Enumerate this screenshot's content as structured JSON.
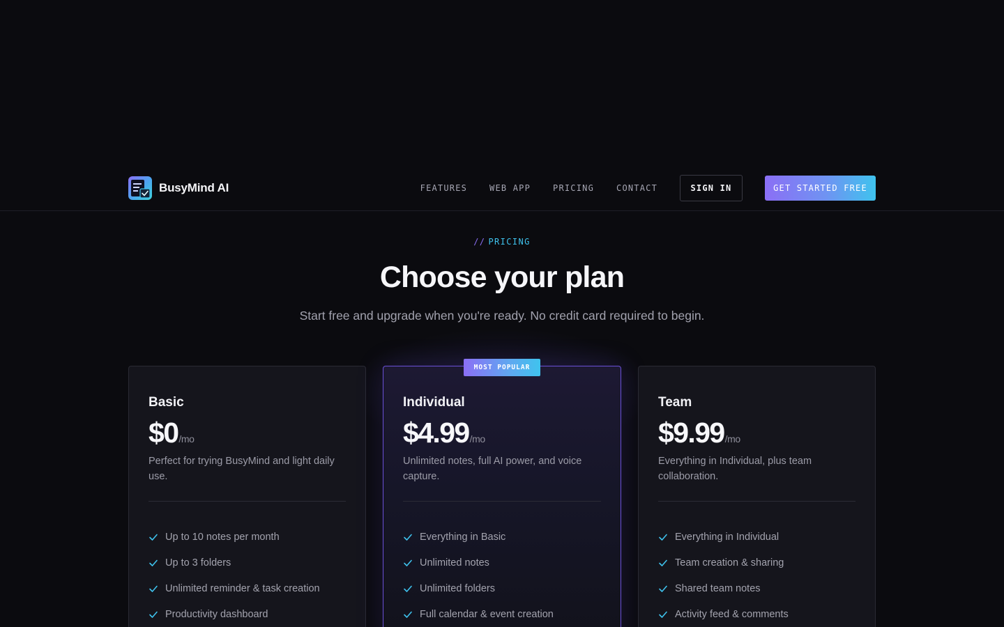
{
  "brand": {
    "name": "BusyMind AI",
    "logo_icon": "notes-check-logo-icon"
  },
  "nav": {
    "links": [
      "FEATURES",
      "WEB APP",
      "PRICING",
      "CONTACT"
    ],
    "sign_in": "SIGN IN",
    "cta": "GET STARTED FREE"
  },
  "hero": {
    "eyebrow_prefix": "//",
    "eyebrow": "PRICING",
    "title": "Choose your plan",
    "subtitle": "Start free and upgrade when you're ready. No credit card required to begin."
  },
  "plans": [
    {
      "name": "Basic",
      "price": "$0",
      "period": "/mo",
      "description": "Perfect for trying BusyMind and light daily use.",
      "features": [
        "Up to 10 notes per month",
        "Up to 3 folders",
        "Unlimited reminder & task creation",
        "Productivity dashboard"
      ]
    },
    {
      "name": "Individual",
      "badge": "MOST POPULAR",
      "price": "$4.99",
      "period": "/mo",
      "description": "Unlimited notes, full AI power, and voice capture.",
      "features": [
        "Everything in Basic",
        "Unlimited notes",
        "Unlimited folders",
        "Full calendar & event creation"
      ]
    },
    {
      "name": "Team",
      "price": "$9.99",
      "period": "/mo",
      "description": "Everything in Individual, plus team collaboration.",
      "features": [
        "Everything in Individual",
        "Team creation & sharing",
        "Shared team notes",
        "Activity feed & comments"
      ]
    }
  ],
  "colors": {
    "background": "#0b0b0f",
    "accent_purple": "#8b6ff5",
    "accent_cyan": "#3fc3ee",
    "card": "#15151c",
    "featured_border": "#6a50d8"
  }
}
